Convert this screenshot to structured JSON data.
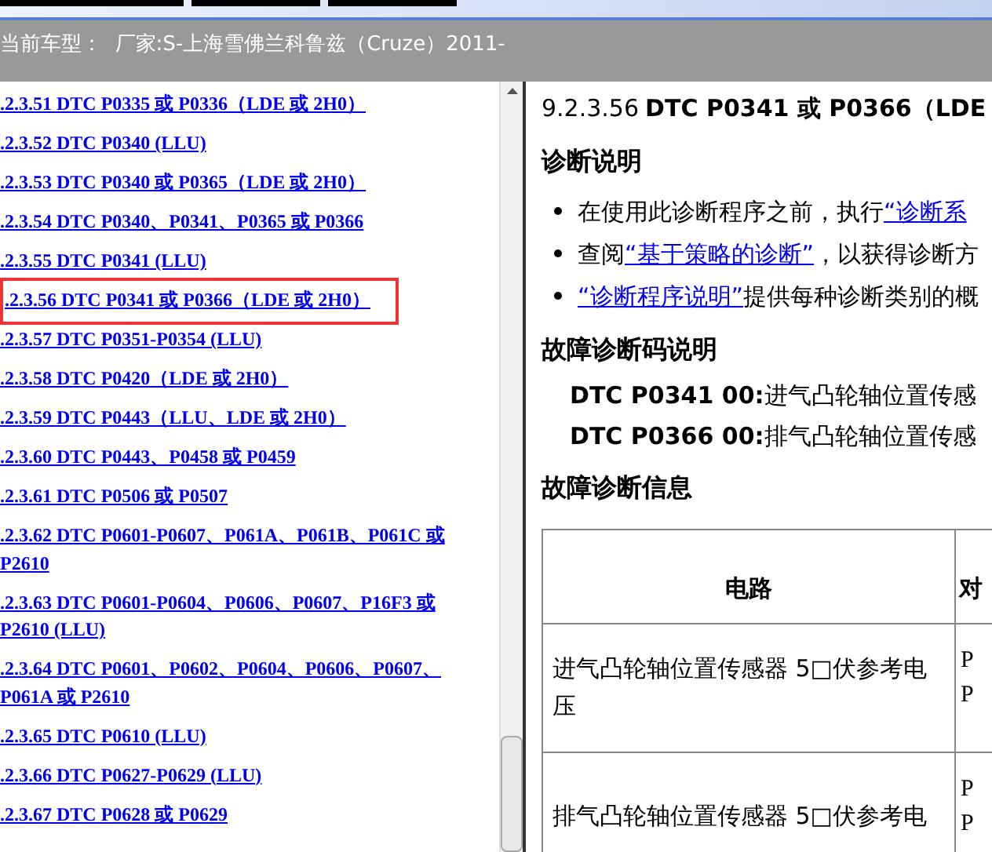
{
  "vehicle_bar": {
    "text": "当前车型：  厂家:S-上海雪佛兰科鲁兹（Cruze）2011-"
  },
  "nav_links": [
    {
      "label": ".2.3.51 DTC P0335 或 P0336（LDE 或 2H0）",
      "selected": false
    },
    {
      "label": ".2.3.52 DTC P0340 (LLU)",
      "selected": false
    },
    {
      "label": ".2.3.53 DTC P0340 或 P0365（LDE 或 2H0）",
      "selected": false
    },
    {
      "label": ".2.3.54 DTC P0340、P0341、P0365 或 P0366",
      "selected": false
    },
    {
      "label": ".2.3.55 DTC P0341 (LLU)",
      "selected": false
    },
    {
      "label": ".2.3.56 DTC P0341 或 P0366（LDE 或 2H0）",
      "selected": true
    },
    {
      "label": ".2.3.57 DTC P0351-P0354 (LLU)",
      "selected": false
    },
    {
      "label": ".2.3.58 DTC P0420（LDE 或 2H0）",
      "selected": false
    },
    {
      "label": ".2.3.59 DTC P0443（LLU、LDE 或 2H0）",
      "selected": false
    },
    {
      "label": ".2.3.60 DTC P0443、P0458 或 P0459",
      "selected": false
    },
    {
      "label": ".2.3.61 DTC P0506 或 P0507",
      "selected": false
    },
    {
      "label": ".2.3.62 DTC P0601-P0607、P061A、P061B、P061C 或 P2610",
      "selected": false
    },
    {
      "label": ".2.3.63 DTC P0601-P0604、P0606、P0607、P16F3 或 P2610 (LLU)",
      "selected": false
    },
    {
      "label": ".2.3.64 DTC P0601、P0602、P0604、P0606、P0607、P061A 或 P2610",
      "selected": false
    },
    {
      "label": ".2.3.65 DTC P0610 (LLU)",
      "selected": false
    },
    {
      "label": ".2.3.66 DTC P0627-P0629 (LLU)",
      "selected": false
    },
    {
      "label": ".2.3.67 DTC P0628 或 P0629",
      "selected": false
    }
  ],
  "article": {
    "number": "9.2.3.56",
    "title": "DTC P0341 或 P0366（LDE",
    "sections": [
      {
        "heading": "诊断说明",
        "kind": "bullets",
        "items": [
          {
            "before": "在使用此诊断程序之前，执行",
            "link": "“诊断系"
          },
          {
            "before": "查阅",
            "link": "“基于策略的诊断”",
            "after": "，以获得诊断方"
          },
          {
            "link": "“诊断程序说明”",
            "after": "提供每种诊断类别的概"
          }
        ]
      },
      {
        "heading": "故障诊断码说明",
        "kind": "codes",
        "items": [
          {
            "code": "DTC P0341 00:",
            "text": "进气凸轮轴位置传感"
          },
          {
            "code": "DTC P0366 00:",
            "text": "排气凸轮轴位置传感"
          }
        ]
      },
      {
        "heading": "故障诊断信息",
        "kind": "table",
        "columns": [
          "电路",
          "对"
        ],
        "rows": [
          {
            "circuit": "进气凸轮轴位置传感器 5□伏参考电压",
            "column_2": [
              "P",
              "P"
            ]
          },
          {
            "circuit": "排气凸轮轴位置传感器 5□伏参考电",
            "column_2": [
              "P",
              "P"
            ]
          }
        ]
      }
    ]
  }
}
